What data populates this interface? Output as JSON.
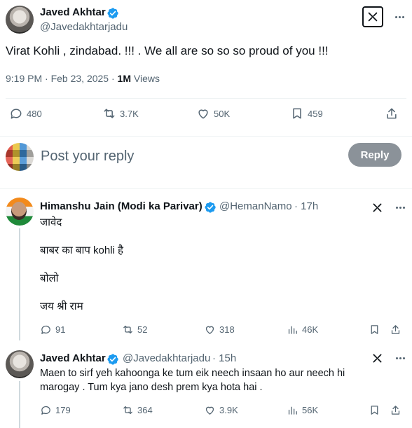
{
  "main_tweet": {
    "author_name": "Javed Akhtar",
    "author_handle": "@Javedakhtarjadu",
    "text": "Virat Kohli , zindabad. !!! . We all are so so so proud of you !!!",
    "time": "9:19 PM · Feb 23, 2025 · ",
    "views_count": "1M",
    "views_label": " Views",
    "stats": {
      "replies": "480",
      "reposts": "3.7K",
      "likes": "50K",
      "bookmarks": "459"
    }
  },
  "reply_composer": {
    "placeholder": "Post your reply",
    "button_label": "Reply"
  },
  "replies": [
    {
      "author_name": "Himanshu Jain (Modi ka Parivar)",
      "author_handle": "@HemanNamo",
      "time": "· 17h",
      "lines": [
        "जावेद",
        "बाबर का बाप kohli है",
        "बोलो",
        "जय श्री राम"
      ],
      "stats": {
        "replies": "91",
        "reposts": "52",
        "likes": "318",
        "views": "46K"
      }
    },
    {
      "author_name": "Javed Akhtar",
      "author_handle": "@Javedakhtarjadu",
      "time": "· 15h",
      "lines": [
        "Maen to sirf yeh kahoonga ke tum eik neech insaan ho aur neech hi",
        "marogay . Tum kya jano desh prem kya hota hai ."
      ],
      "stats": {
        "replies": "179",
        "reposts": "364",
        "likes": "3.9K",
        "views": "56K"
      }
    }
  ],
  "colors": {
    "verified": "#1d9bf0",
    "secondary_text": "#536471",
    "reply_button": "#8b9299"
  },
  "icons": [
    "verified-icon",
    "grok-icon",
    "more-icon",
    "reply-icon",
    "repost-icon",
    "like-icon",
    "bookmark-icon",
    "share-icon",
    "views-icon"
  ]
}
